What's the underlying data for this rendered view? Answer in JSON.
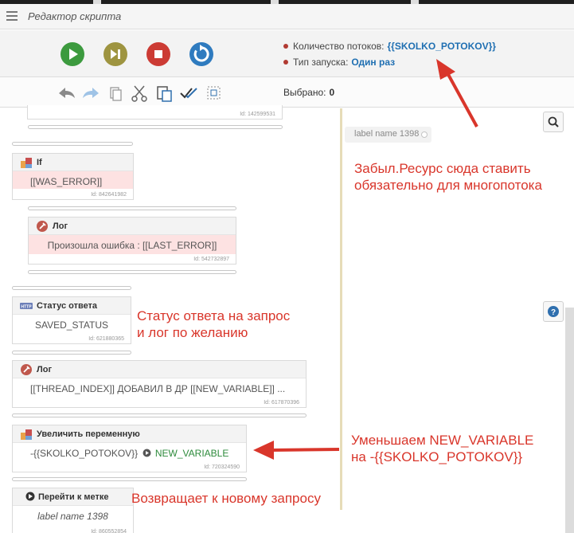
{
  "window": {
    "title": "Редактор скрипта"
  },
  "toolbar": {
    "thread_count_label": "Количество потоков:",
    "thread_count_value": "{{SKOLKO_POTOKOV}}",
    "launch_type_label": "Тип запуска:",
    "launch_type_value": "Один раз",
    "selected_label": "Выбрано:",
    "selected_value": "0"
  },
  "canvas": {
    "top_block_id": "Id: 142599531",
    "label_tag": "label name 1398",
    "blocks": [
      {
        "title": "If",
        "icon": "if-icon",
        "body": "[[WAS_ERROR]]",
        "id": "Id: 842641982"
      },
      {
        "title": "Лог",
        "icon": "log-icon",
        "body": "Произошла ошибка : [[LAST_ERROR]]",
        "id": "Id: 542732897"
      },
      {
        "title": "Статус ответа",
        "icon": "http-icon",
        "body": "SAVED_STATUS",
        "id": "Id: 621880365"
      },
      {
        "title": "Лог",
        "icon": "log-icon",
        "body": "[[THREAD_INDEX]] ДОБАВИЛ В ДР [[NEW_VARIABLE]] ...",
        "id": "Id: 617870396"
      },
      {
        "title": "Увеличить переменную",
        "icon": "variable-icon",
        "body_prefix": "-{{SKOLKO_POTOKOV}}",
        "body_target": "NEW_VARIABLE",
        "id": "Id: 720324590"
      },
      {
        "title": "Перейти к метке",
        "icon": "goto-icon",
        "body": "label name 1398",
        "id": "Id: 860552854"
      }
    ]
  },
  "annotations": {
    "resource_note_line1": "Забыл.Ресурс сюда ставить",
    "resource_note_line2": "обязательно для многопотока",
    "status_note_line1": "Статус ответа на запрос",
    "status_note_line2": "и лог по желанию",
    "decrease_note_line1": "Уменьшаем NEW_VARIABLE",
    "decrease_note_line2": "на -{{SKOLKO_POTOKOV}}",
    "return_note": "Возвращает к новому запросу"
  },
  "colors": {
    "accent_link": "#1f6fb2",
    "annotation_red": "#d9362b",
    "play_green": "#3c9a3e",
    "next_olive": "#9e9440",
    "stop_red": "#cc3b34",
    "restart_blue": "#2f7bbf",
    "error_pink": "#fde2e2"
  }
}
